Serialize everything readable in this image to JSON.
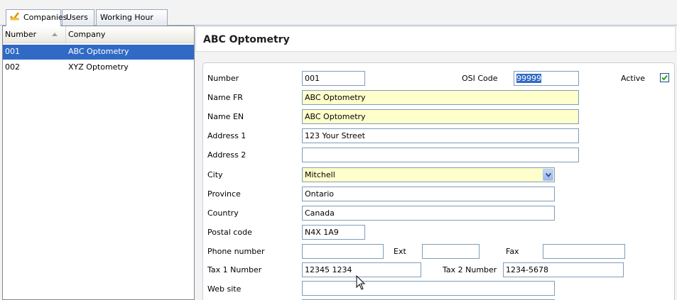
{
  "tabs": [
    {
      "label": "Companies",
      "icon": "companies-icon"
    },
    {
      "label": "Users"
    },
    {
      "label": "Working Hour"
    }
  ],
  "list": {
    "columns": {
      "number": "Number",
      "company": "Company"
    },
    "rows": [
      {
        "number": "001",
        "company": "ABC Optometry"
      },
      {
        "number": "002",
        "company": "XYZ Optometry"
      }
    ]
  },
  "detail": {
    "title": "ABC Optometry",
    "labels": {
      "number": "Number",
      "osi_code": "OSI Code",
      "active": "Active",
      "name_fr": "Name FR",
      "name_en": "Name EN",
      "address1": "Address 1",
      "address2": "Address 2",
      "city": "City",
      "province": "Province",
      "country": "Country",
      "postal_code": "Postal code",
      "phone": "Phone number",
      "ext": "Ext",
      "fax": "Fax",
      "tax1": "Tax 1 Number",
      "tax2": "Tax 2 Number",
      "website": "Web site"
    },
    "values": {
      "number": "001",
      "osi_code": "99999",
      "active": true,
      "name_fr": "ABC Optometry",
      "name_en": "ABC Optometry",
      "address1": "123 Your Street",
      "address2": "",
      "city": "Mitchell",
      "province": "Ontario",
      "country": "Canada",
      "postal_code": "N4X 1A9",
      "phone": "",
      "ext": "",
      "fax": "",
      "tax1": "12345 1234",
      "tax2": "1234-5678",
      "website": ""
    }
  },
  "colors": {
    "selection": "#316ac5",
    "required_field": "#ffffcc",
    "field_border": "#7f9db9"
  }
}
